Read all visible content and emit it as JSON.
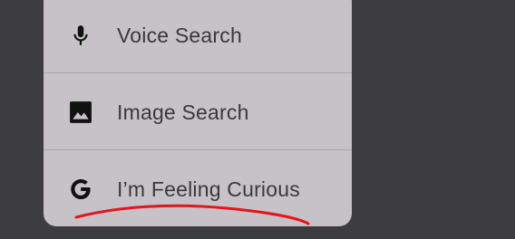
{
  "menu": {
    "items": [
      {
        "label": "Voice Search",
        "icon": "microphone-icon"
      },
      {
        "label": "Image Search",
        "icon": "image-icon"
      },
      {
        "label": "I’m Feeling Curious",
        "icon": "google-g-icon"
      }
    ]
  },
  "colors": {
    "background": "#3d3c3f",
    "menu_background": "#c6c2c7",
    "text": "#3a393c",
    "icon": "#111111",
    "annotation": "#e8141a"
  }
}
